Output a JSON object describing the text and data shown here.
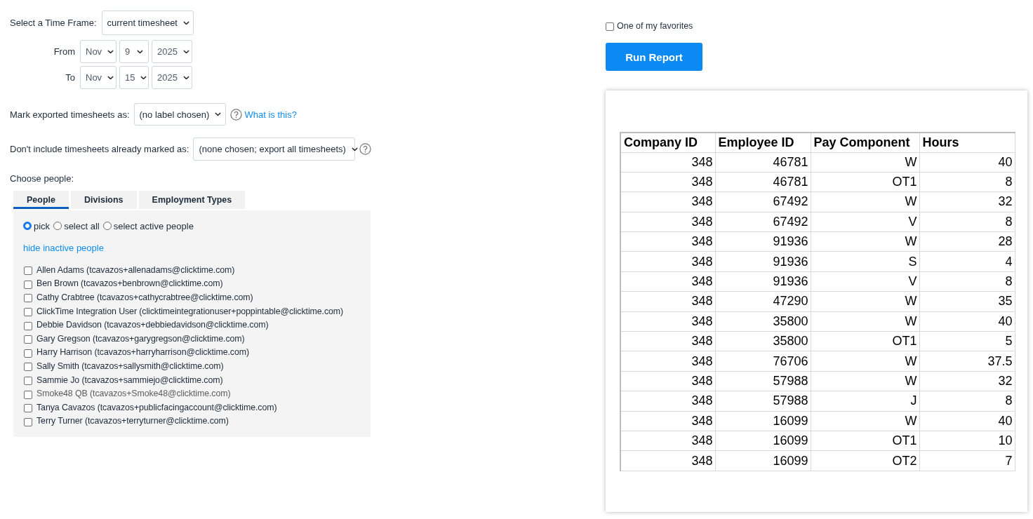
{
  "time_frame": {
    "label": "Select a Time Frame:",
    "value": "current timesheet"
  },
  "date_range": [
    {
      "label": "From",
      "month": "Nov",
      "day": "9",
      "year": "2025"
    },
    {
      "label": "To",
      "month": "Nov",
      "day": "15",
      "year": "2025"
    }
  ],
  "mark_exported": {
    "label": "Mark exported timesheets as:",
    "value": "(no label chosen)",
    "help_link": "What is this?"
  },
  "exclude_marked": {
    "label": "Don't include timesheets already marked as:",
    "value": "(none chosen; export all timesheets)"
  },
  "choose_people": {
    "label": "Choose people:",
    "tabs": [
      {
        "label": "People",
        "selected": true
      },
      {
        "label": "Divisions",
        "selected": false
      },
      {
        "label": "Employment Types",
        "selected": false
      }
    ],
    "modes": [
      {
        "label": "pick",
        "selected": true
      },
      {
        "label": "select all",
        "selected": false
      },
      {
        "label": "select active people",
        "selected": false
      }
    ],
    "toggle_link": "hide inactive people",
    "people": [
      {
        "label": "Allen Adams (tcavazos+allenadams@clicktime.com)",
        "checked": false,
        "inactive": false
      },
      {
        "label": "Ben Brown (tcavazos+benbrown@clicktime.com)",
        "checked": false,
        "inactive": false
      },
      {
        "label": "Cathy Crabtree (tcavazos+cathycrabtree@clicktime.com)",
        "checked": false,
        "inactive": false
      },
      {
        "label": "ClickTime Integration User (clicktimeintegrationuser+poppintable@clicktime.com)",
        "checked": false,
        "inactive": false
      },
      {
        "label": "Debbie Davidson (tcavazos+debbiedavidson@clicktime.com)",
        "checked": false,
        "inactive": false
      },
      {
        "label": "Gary Gregson (tcavazos+garygregson@clicktime.com)",
        "checked": false,
        "inactive": false
      },
      {
        "label": "Harry Harrison (tcavazos+harryharrison@clicktime.com)",
        "checked": false,
        "inactive": false
      },
      {
        "label": "Sally Smith (tcavazos+sallysmith@clicktime.com)",
        "checked": false,
        "inactive": false
      },
      {
        "label": "Sammie Jo (tcavazos+sammiejo@clicktime.com)",
        "checked": false,
        "inactive": false
      },
      {
        "label": "Smoke48 QB (tcavazos+Smoke48@clicktime.com)",
        "checked": false,
        "inactive": true
      },
      {
        "label": "Tanya Cavazos (tcavazos+publicfacingaccount@clicktime.com)",
        "checked": false,
        "inactive": false
      },
      {
        "label": "Terry Turner (tcavazos+terryturner@clicktime.com)",
        "checked": false,
        "inactive": false
      }
    ]
  },
  "favorite": {
    "label": "One of my favorites",
    "checked": false
  },
  "run_button": "Run Report",
  "report_table": {
    "columns": [
      "Company ID",
      "Employee ID",
      "Pay Component",
      "Hours"
    ],
    "rows": [
      [
        "348",
        "46781",
        "W",
        "40"
      ],
      [
        "348",
        "46781",
        "OT1",
        "8"
      ],
      [
        "348",
        "67492",
        "W",
        "32"
      ],
      [
        "348",
        "67492",
        "V",
        "8"
      ],
      [
        "348",
        "91936",
        "W",
        "28"
      ],
      [
        "348",
        "91936",
        "S",
        "4"
      ],
      [
        "348",
        "91936",
        "V",
        "8"
      ],
      [
        "348",
        "47290",
        "W",
        "35"
      ],
      [
        "348",
        "35800",
        "W",
        "40"
      ],
      [
        "348",
        "35800",
        "OT1",
        "5"
      ],
      [
        "348",
        "76706",
        "W",
        "37.5"
      ],
      [
        "348",
        "57988",
        "W",
        "32"
      ],
      [
        "348",
        "57988",
        "J",
        "8"
      ],
      [
        "348",
        "16099",
        "W",
        "40"
      ],
      [
        "348",
        "16099",
        "OT1",
        "10"
      ],
      [
        "348",
        "16099",
        "OT2",
        "7"
      ]
    ]
  }
}
